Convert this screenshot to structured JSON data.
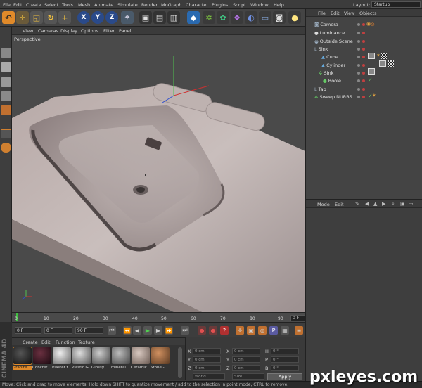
{
  "menubar": {
    "items": [
      "File",
      "Edit",
      "Create",
      "Select",
      "Tools",
      "Mesh",
      "Animate",
      "Simulate",
      "Render",
      "MoGraph",
      "Character",
      "Plugins",
      "Script",
      "Window",
      "Help"
    ],
    "layout_label": "Layout:",
    "layout_value": "Startup"
  },
  "toolbar": {
    "axis_x": "X",
    "axis_y": "Y",
    "axis_z": "Z"
  },
  "viewport": {
    "menu": [
      "View",
      "Cameras",
      "Display",
      "Options",
      "Filter",
      "Panel"
    ],
    "label": "Perspective"
  },
  "timeline": {
    "ticks": [
      "0",
      "10",
      "20",
      "30",
      "40",
      "50",
      "60",
      "70",
      "80",
      "90"
    ],
    "end_frame": "0 F"
  },
  "transport": {
    "current_frame": "0 F",
    "min_frame": "0 F",
    "max_frame": "90 F"
  },
  "materials": {
    "menu": [
      "Create",
      "Edit",
      "Function",
      "Texture"
    ],
    "items": [
      {
        "name": "Granite",
        "color": "#2a2a2a"
      },
      {
        "name": "Concret",
        "color": "#3a1e22"
      },
      {
        "name": "Plaster f",
        "color": "#8a8a8a"
      },
      {
        "name": "Plastic G",
        "color": "#9a9a9a"
      },
      {
        "name": "Glossy",
        "color": "#7a7a7a"
      },
      {
        "name": "mineral",
        "color": "#6a6a6a"
      },
      {
        "name": "Ceramic",
        "color": "#8a7a72"
      },
      {
        "name": "Stone -",
        "color": "#8a6a52"
      }
    ],
    "selected": "Granite"
  },
  "coords": {
    "header": "--",
    "rows": [
      {
        "axis": "X",
        "pos": "0 cm",
        "size_axis": "X",
        "size": "0 cm",
        "rot_axis": "H",
        "rot": "0 °"
      },
      {
        "axis": "Y",
        "pos": "0 cm",
        "size_axis": "Y",
        "size": "0 cm",
        "rot_axis": "P",
        "rot": "0 °"
      },
      {
        "axis": "Z",
        "pos": "0 cm",
        "size_axis": "Z",
        "size": "0 cm",
        "rot_axis": "B",
        "rot": "0 °"
      }
    ],
    "mode": "World",
    "scale_mode": "Size",
    "apply_label": "Apply"
  },
  "objects": {
    "menu": [
      "File",
      "Edit",
      "View",
      "Objects"
    ],
    "items": [
      {
        "name": "Camera",
        "indent": 0
      },
      {
        "name": "Luminance",
        "indent": 0
      },
      {
        "name": "Outside Scene",
        "indent": 0
      },
      {
        "name": "Sink",
        "indent": 0
      },
      {
        "name": "Cube",
        "indent": 1
      },
      {
        "name": "Cylinder",
        "indent": 1
      },
      {
        "name": "Sink",
        "indent": 1
      },
      {
        "name": "Boole",
        "indent": 2
      },
      {
        "name": "Tap",
        "indent": 0
      },
      {
        "name": "Sweep NURBS",
        "indent": 0
      }
    ]
  },
  "attributes": {
    "menu": [
      "Mode",
      "Edit"
    ]
  },
  "status": {
    "text": "Move: Click and drag to move elements. Hold down SHIFT to quantize movement / add to the selection in point mode, CTRL to remove."
  },
  "branding": {
    "vertical": "CINEMA 4D",
    "watermark": "pxleyes.com"
  }
}
